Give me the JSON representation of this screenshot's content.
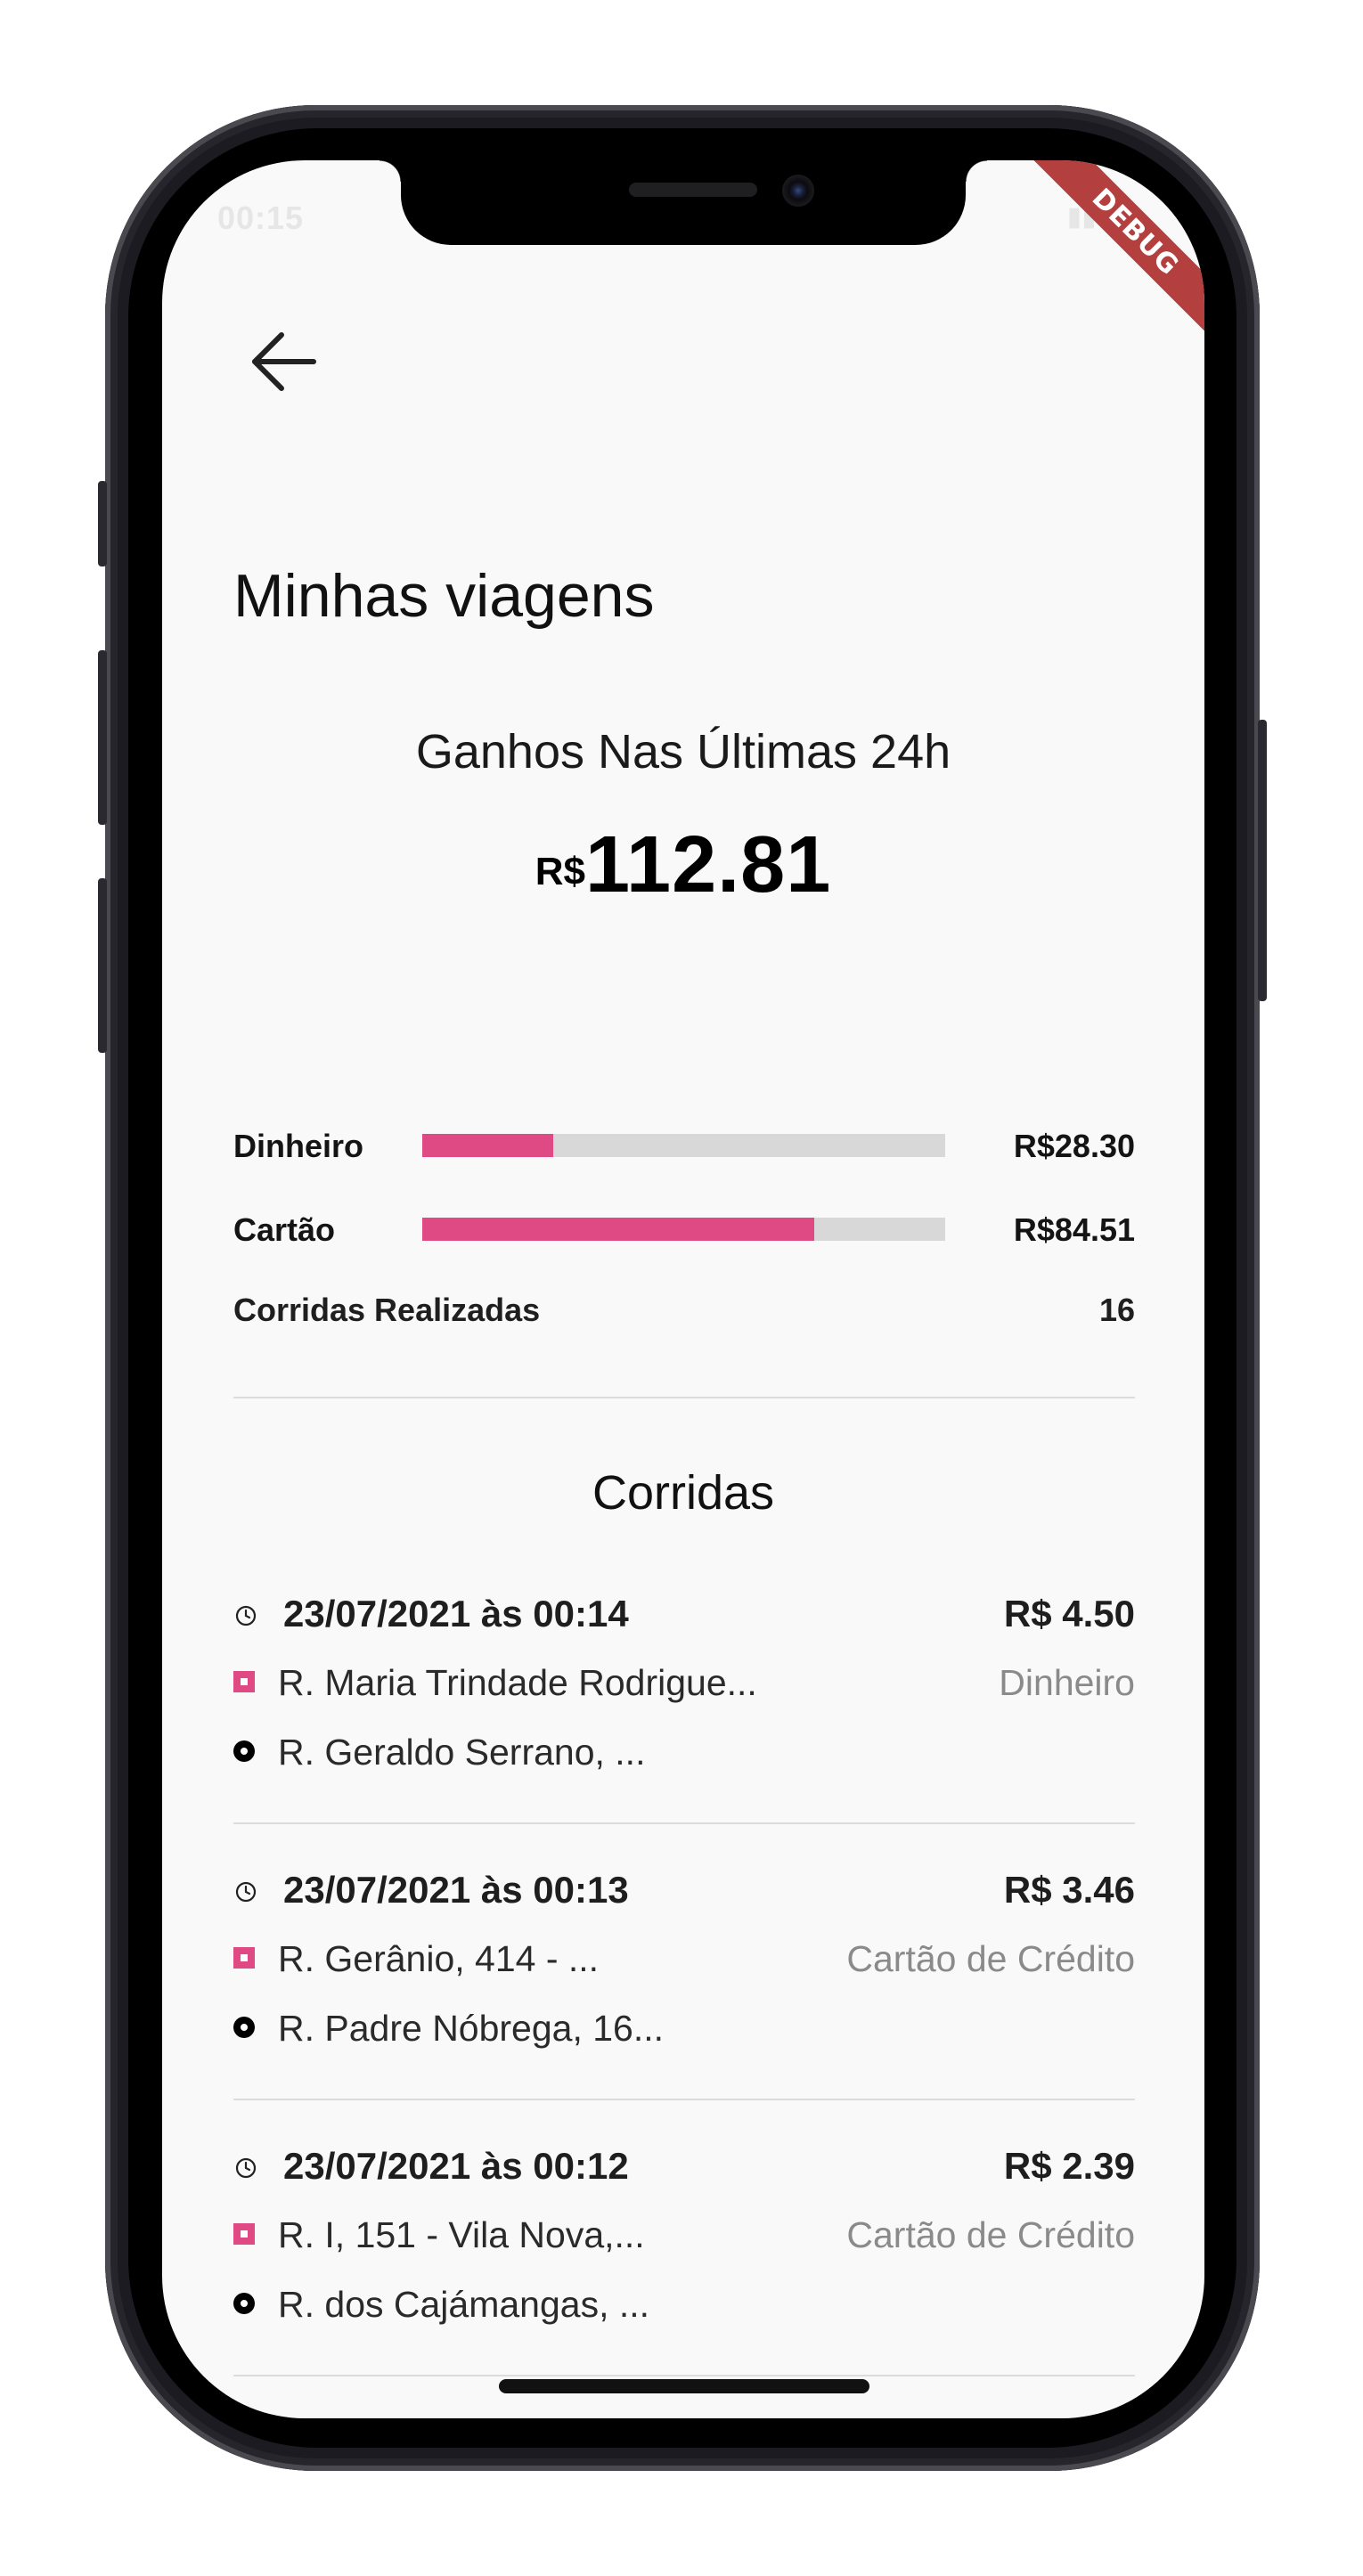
{
  "status_bar": {
    "time": "00:15",
    "signal": "▮▮",
    "wifi": "◔",
    "battery": "▮"
  },
  "debug_banner": "DEBUG",
  "navigation": {
    "back_icon": "arrow-left-icon"
  },
  "page_title": "Minhas viagens",
  "summary": {
    "title": "Ganhos Nas Últimas 24h",
    "currency": "R$",
    "total": "112.81",
    "breakdown": [
      {
        "label": "Dinheiro",
        "value": "R$28.30",
        "fraction": 0.25
      },
      {
        "label": "Cartão",
        "value": "R$84.51",
        "fraction": 0.75
      }
    ],
    "rides_label": "Corridas Realizadas",
    "rides_count": "16"
  },
  "rides_section": {
    "title": "Corridas",
    "items": [
      {
        "datetime": "23/07/2021 às 00:14",
        "price": "R$ 4.50",
        "origin": "R. Maria Trindade Rodrigue...",
        "destination": "R. Geraldo Serrano, ...",
        "payment": "Dinheiro"
      },
      {
        "datetime": "23/07/2021 às 00:13",
        "price": "R$ 3.46",
        "origin": "R. Gerânio, 414 - ...",
        "destination": "R. Padre Nóbrega, 16...",
        "payment": "Cartão de Crédito"
      },
      {
        "datetime": "23/07/2021 às 00:12",
        "price": "R$ 2.39",
        "origin": "R. I, 151 - Vila Nova,...",
        "destination": "R. dos Cajámangas, ...",
        "payment": "Cartão de Crédito"
      }
    ]
  },
  "colors": {
    "accent": "#e04a84",
    "track": "#d8d8d8",
    "muted_text": "#8a8a8a",
    "debug_banner": "#b3403f"
  }
}
